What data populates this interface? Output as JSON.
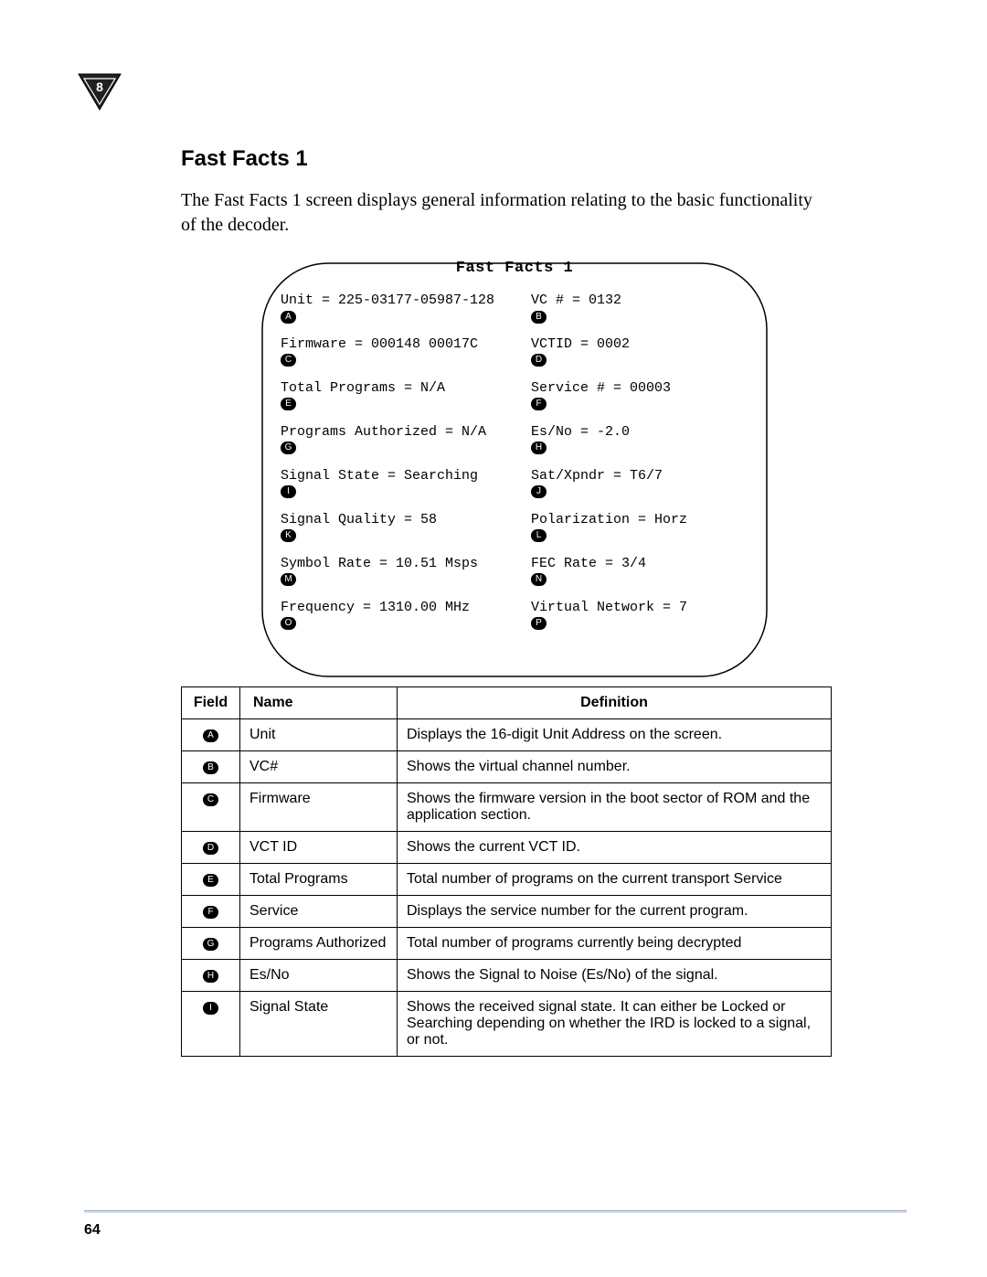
{
  "chapter_number": "8",
  "heading": "Fast Facts 1",
  "intro": "The Fast Facts 1 screen displays general information relating to the basic functionality of the decoder.",
  "screen": {
    "title": "Fast Facts 1",
    "left": [
      {
        "m": "A",
        "text": "Unit = 225-03177-05987-128"
      },
      {
        "m": "C",
        "text": "Firmware = 000148 00017C"
      },
      {
        "m": "E",
        "text": "Total Programs = N/A"
      },
      {
        "m": "G",
        "text": "Programs Authorized = N/A"
      },
      {
        "m": "I",
        "text": "Signal State = Searching"
      },
      {
        "m": "K",
        "text": "Signal Quality = 58"
      },
      {
        "m": "M",
        "text": "Symbol Rate = 10.51 Msps"
      },
      {
        "m": "O",
        "text": "Frequency = 1310.00 MHz"
      }
    ],
    "right": [
      {
        "m": "B",
        "text": "VC # = 0132"
      },
      {
        "m": "D",
        "text": "VCTID = 0002"
      },
      {
        "m": "F",
        "text": "Service # = 00003"
      },
      {
        "m": "H",
        "text": "Es/No = -2.0"
      },
      {
        "m": "J",
        "text": "Sat/Xpndr = T6/7"
      },
      {
        "m": "L",
        "text": "Polarization = Horz"
      },
      {
        "m": "N",
        "text": "FEC Rate = 3/4"
      },
      {
        "m": "P",
        "text": "Virtual Network = 7"
      }
    ]
  },
  "table": {
    "headers": {
      "field": "Field",
      "name": "Name",
      "def": "Definition"
    },
    "rows": [
      {
        "m": "A",
        "name": "Unit",
        "def": "Displays the 16-digit Unit Address on the screen."
      },
      {
        "m": "B",
        "name": "VC#",
        "def": "Shows the virtual channel number."
      },
      {
        "m": "C",
        "name": "Firmware",
        "def": "Shows the firmware version in the boot sector of ROM and the application section."
      },
      {
        "m": "D",
        "name": "VCT ID",
        "def": "Shows the current VCT ID."
      },
      {
        "m": "E",
        "name": "Total Programs",
        "def": "Total number of programs on the current transport Service"
      },
      {
        "m": "F",
        "name": "Service",
        "def": "Displays the service number for the current program."
      },
      {
        "m": "G",
        "name": "Programs Authorized",
        "def": "Total number of programs currently being decrypted"
      },
      {
        "m": "H",
        "name": "Es/No",
        "def": "Shows the Signal to Noise (Es/No) of the signal."
      },
      {
        "m": "I",
        "name": "Signal State",
        "def": "Shows the received signal state. It can either be Locked or Searching depending on whether the IRD is locked to a signal, or not."
      }
    ]
  },
  "page_number": "64"
}
